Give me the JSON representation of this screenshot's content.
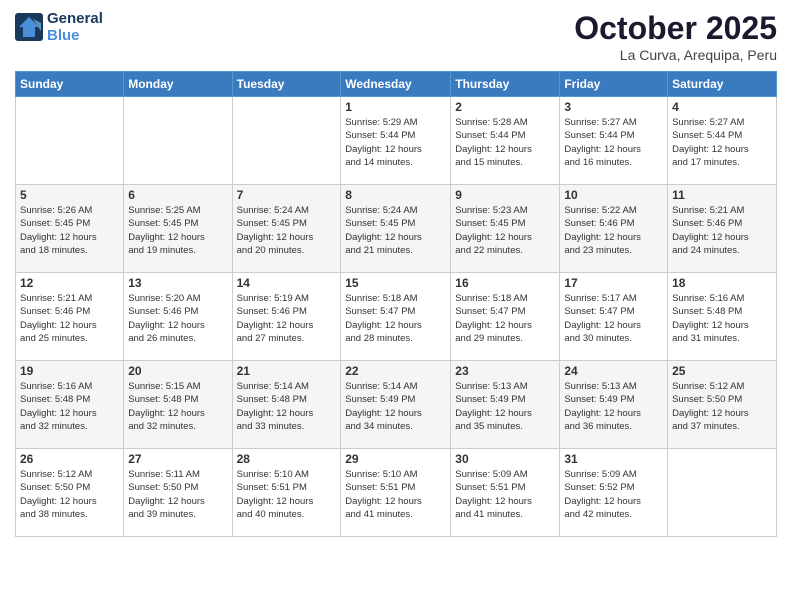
{
  "logo": {
    "line1": "General",
    "line2": "Blue"
  },
  "title": "October 2025",
  "subtitle": "La Curva, Arequipa, Peru",
  "days_of_week": [
    "Sunday",
    "Monday",
    "Tuesday",
    "Wednesday",
    "Thursday",
    "Friday",
    "Saturday"
  ],
  "weeks": [
    [
      {
        "day": "",
        "info": ""
      },
      {
        "day": "",
        "info": ""
      },
      {
        "day": "",
        "info": ""
      },
      {
        "day": "1",
        "info": "Sunrise: 5:29 AM\nSunset: 5:44 PM\nDaylight: 12 hours\nand 14 minutes."
      },
      {
        "day": "2",
        "info": "Sunrise: 5:28 AM\nSunset: 5:44 PM\nDaylight: 12 hours\nand 15 minutes."
      },
      {
        "day": "3",
        "info": "Sunrise: 5:27 AM\nSunset: 5:44 PM\nDaylight: 12 hours\nand 16 minutes."
      },
      {
        "day": "4",
        "info": "Sunrise: 5:27 AM\nSunset: 5:44 PM\nDaylight: 12 hours\nand 17 minutes."
      }
    ],
    [
      {
        "day": "5",
        "info": "Sunrise: 5:26 AM\nSunset: 5:45 PM\nDaylight: 12 hours\nand 18 minutes."
      },
      {
        "day": "6",
        "info": "Sunrise: 5:25 AM\nSunset: 5:45 PM\nDaylight: 12 hours\nand 19 minutes."
      },
      {
        "day": "7",
        "info": "Sunrise: 5:24 AM\nSunset: 5:45 PM\nDaylight: 12 hours\nand 20 minutes."
      },
      {
        "day": "8",
        "info": "Sunrise: 5:24 AM\nSunset: 5:45 PM\nDaylight: 12 hours\nand 21 minutes."
      },
      {
        "day": "9",
        "info": "Sunrise: 5:23 AM\nSunset: 5:45 PM\nDaylight: 12 hours\nand 22 minutes."
      },
      {
        "day": "10",
        "info": "Sunrise: 5:22 AM\nSunset: 5:46 PM\nDaylight: 12 hours\nand 23 minutes."
      },
      {
        "day": "11",
        "info": "Sunrise: 5:21 AM\nSunset: 5:46 PM\nDaylight: 12 hours\nand 24 minutes."
      }
    ],
    [
      {
        "day": "12",
        "info": "Sunrise: 5:21 AM\nSunset: 5:46 PM\nDaylight: 12 hours\nand 25 minutes."
      },
      {
        "day": "13",
        "info": "Sunrise: 5:20 AM\nSunset: 5:46 PM\nDaylight: 12 hours\nand 26 minutes."
      },
      {
        "day": "14",
        "info": "Sunrise: 5:19 AM\nSunset: 5:46 PM\nDaylight: 12 hours\nand 27 minutes."
      },
      {
        "day": "15",
        "info": "Sunrise: 5:18 AM\nSunset: 5:47 PM\nDaylight: 12 hours\nand 28 minutes."
      },
      {
        "day": "16",
        "info": "Sunrise: 5:18 AM\nSunset: 5:47 PM\nDaylight: 12 hours\nand 29 minutes."
      },
      {
        "day": "17",
        "info": "Sunrise: 5:17 AM\nSunset: 5:47 PM\nDaylight: 12 hours\nand 30 minutes."
      },
      {
        "day": "18",
        "info": "Sunrise: 5:16 AM\nSunset: 5:48 PM\nDaylight: 12 hours\nand 31 minutes."
      }
    ],
    [
      {
        "day": "19",
        "info": "Sunrise: 5:16 AM\nSunset: 5:48 PM\nDaylight: 12 hours\nand 32 minutes."
      },
      {
        "day": "20",
        "info": "Sunrise: 5:15 AM\nSunset: 5:48 PM\nDaylight: 12 hours\nand 32 minutes."
      },
      {
        "day": "21",
        "info": "Sunrise: 5:14 AM\nSunset: 5:48 PM\nDaylight: 12 hours\nand 33 minutes."
      },
      {
        "day": "22",
        "info": "Sunrise: 5:14 AM\nSunset: 5:49 PM\nDaylight: 12 hours\nand 34 minutes."
      },
      {
        "day": "23",
        "info": "Sunrise: 5:13 AM\nSunset: 5:49 PM\nDaylight: 12 hours\nand 35 minutes."
      },
      {
        "day": "24",
        "info": "Sunrise: 5:13 AM\nSunset: 5:49 PM\nDaylight: 12 hours\nand 36 minutes."
      },
      {
        "day": "25",
        "info": "Sunrise: 5:12 AM\nSunset: 5:50 PM\nDaylight: 12 hours\nand 37 minutes."
      }
    ],
    [
      {
        "day": "26",
        "info": "Sunrise: 5:12 AM\nSunset: 5:50 PM\nDaylight: 12 hours\nand 38 minutes."
      },
      {
        "day": "27",
        "info": "Sunrise: 5:11 AM\nSunset: 5:50 PM\nDaylight: 12 hours\nand 39 minutes."
      },
      {
        "day": "28",
        "info": "Sunrise: 5:10 AM\nSunset: 5:51 PM\nDaylight: 12 hours\nand 40 minutes."
      },
      {
        "day": "29",
        "info": "Sunrise: 5:10 AM\nSunset: 5:51 PM\nDaylight: 12 hours\nand 41 minutes."
      },
      {
        "day": "30",
        "info": "Sunrise: 5:09 AM\nSunset: 5:51 PM\nDaylight: 12 hours\nand 41 minutes."
      },
      {
        "day": "31",
        "info": "Sunrise: 5:09 AM\nSunset: 5:52 PM\nDaylight: 12 hours\nand 42 minutes."
      },
      {
        "day": "",
        "info": ""
      }
    ]
  ]
}
